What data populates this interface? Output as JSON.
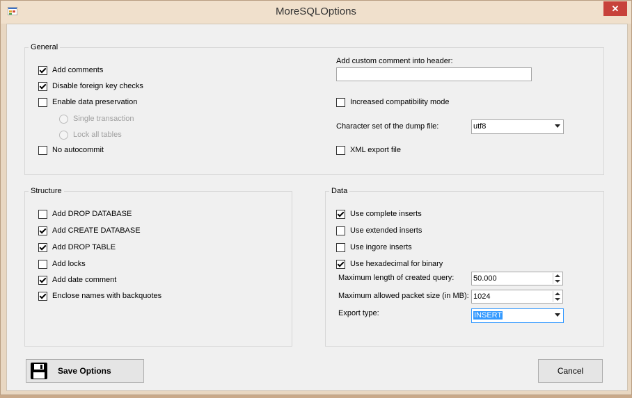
{
  "window": {
    "title": "MoreSQLOptions",
    "close_glyph": "✕"
  },
  "general": {
    "legend": "General",
    "add_comments": {
      "label": "Add comments",
      "checked": true
    },
    "disable_fk_checks": {
      "label": "Disable foreign key checks",
      "checked": true
    },
    "enable_data_preservation": {
      "label": "Enable data preservation",
      "checked": false
    },
    "single_transaction": {
      "label": "Single transaction",
      "enabled": false
    },
    "lock_all_tables": {
      "label": "Lock all tables",
      "enabled": false
    },
    "no_autocommit": {
      "label": "No autocommit",
      "checked": false
    },
    "custom_comment_label": "Add custom comment into header:",
    "custom_comment_value": "",
    "increased_compat": {
      "label": "Increased compatibility mode",
      "checked": false
    },
    "charset_label": "Character set of the dump file:",
    "charset_value": "utf8",
    "xml_export": {
      "label": "XML export file",
      "checked": false
    }
  },
  "structure": {
    "legend": "Structure",
    "add_drop_database": {
      "label": "Add DROP DATABASE",
      "checked": false
    },
    "add_create_database": {
      "label": "Add CREATE DATABASE",
      "checked": true
    },
    "add_drop_table": {
      "label": "Add DROP TABLE",
      "checked": true
    },
    "add_locks": {
      "label": "Add locks",
      "checked": false
    },
    "add_date_comment": {
      "label": "Add date comment",
      "checked": true
    },
    "enclose_backquotes": {
      "label": "Enclose names with backquotes",
      "checked": true
    }
  },
  "data": {
    "legend": "Data",
    "complete_inserts": {
      "label": "Use complete inserts",
      "checked": true
    },
    "extended_inserts": {
      "label": "Use extended inserts",
      "checked": false
    },
    "ignore_inserts": {
      "label": "Use ingore inserts",
      "checked": false
    },
    "hex_binary": {
      "label": "Use hexadecimal for binary",
      "checked": true
    },
    "max_query_label": "Maximum length of created query:",
    "max_query_value": "50.000",
    "max_packet_label": "Maximum allowed packet size (in MB):",
    "max_packet_value": "1024",
    "export_type_label": "Export type:",
    "export_type_value": "INSERT"
  },
  "buttons": {
    "save_label": "Save Options",
    "cancel_label": "Cancel",
    "save_icon": "floppy-disk-icon"
  },
  "colors": {
    "title_bg": "#f0e0cc",
    "close_bg": "#c7423b",
    "client_bg": "#f0f0f0",
    "selection": "#3399ff"
  }
}
